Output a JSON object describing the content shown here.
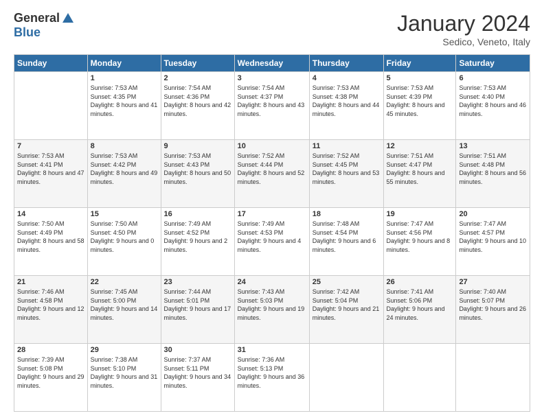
{
  "header": {
    "logo_general": "General",
    "logo_blue": "Blue",
    "month_title": "January 2024",
    "location": "Sedico, Veneto, Italy"
  },
  "days_header": [
    "Sunday",
    "Monday",
    "Tuesday",
    "Wednesday",
    "Thursday",
    "Friday",
    "Saturday"
  ],
  "weeks": [
    [
      {
        "day": "",
        "sunrise": "",
        "sunset": "",
        "daylight": ""
      },
      {
        "day": "1",
        "sunrise": "Sunrise: 7:53 AM",
        "sunset": "Sunset: 4:35 PM",
        "daylight": "Daylight: 8 hours and 41 minutes."
      },
      {
        "day": "2",
        "sunrise": "Sunrise: 7:54 AM",
        "sunset": "Sunset: 4:36 PM",
        "daylight": "Daylight: 8 hours and 42 minutes."
      },
      {
        "day": "3",
        "sunrise": "Sunrise: 7:54 AM",
        "sunset": "Sunset: 4:37 PM",
        "daylight": "Daylight: 8 hours and 43 minutes."
      },
      {
        "day": "4",
        "sunrise": "Sunrise: 7:53 AM",
        "sunset": "Sunset: 4:38 PM",
        "daylight": "Daylight: 8 hours and 44 minutes."
      },
      {
        "day": "5",
        "sunrise": "Sunrise: 7:53 AM",
        "sunset": "Sunset: 4:39 PM",
        "daylight": "Daylight: 8 hours and 45 minutes."
      },
      {
        "day": "6",
        "sunrise": "Sunrise: 7:53 AM",
        "sunset": "Sunset: 4:40 PM",
        "daylight": "Daylight: 8 hours and 46 minutes."
      }
    ],
    [
      {
        "day": "7",
        "sunrise": "Sunrise: 7:53 AM",
        "sunset": "Sunset: 4:41 PM",
        "daylight": "Daylight: 8 hours and 47 minutes."
      },
      {
        "day": "8",
        "sunrise": "Sunrise: 7:53 AM",
        "sunset": "Sunset: 4:42 PM",
        "daylight": "Daylight: 8 hours and 49 minutes."
      },
      {
        "day": "9",
        "sunrise": "Sunrise: 7:53 AM",
        "sunset": "Sunset: 4:43 PM",
        "daylight": "Daylight: 8 hours and 50 minutes."
      },
      {
        "day": "10",
        "sunrise": "Sunrise: 7:52 AM",
        "sunset": "Sunset: 4:44 PM",
        "daylight": "Daylight: 8 hours and 52 minutes."
      },
      {
        "day": "11",
        "sunrise": "Sunrise: 7:52 AM",
        "sunset": "Sunset: 4:45 PM",
        "daylight": "Daylight: 8 hours and 53 minutes."
      },
      {
        "day": "12",
        "sunrise": "Sunrise: 7:51 AM",
        "sunset": "Sunset: 4:47 PM",
        "daylight": "Daylight: 8 hours and 55 minutes."
      },
      {
        "day": "13",
        "sunrise": "Sunrise: 7:51 AM",
        "sunset": "Sunset: 4:48 PM",
        "daylight": "Daylight: 8 hours and 56 minutes."
      }
    ],
    [
      {
        "day": "14",
        "sunrise": "Sunrise: 7:50 AM",
        "sunset": "Sunset: 4:49 PM",
        "daylight": "Daylight: 8 hours and 58 minutes."
      },
      {
        "day": "15",
        "sunrise": "Sunrise: 7:50 AM",
        "sunset": "Sunset: 4:50 PM",
        "daylight": "Daylight: 9 hours and 0 minutes."
      },
      {
        "day": "16",
        "sunrise": "Sunrise: 7:49 AM",
        "sunset": "Sunset: 4:52 PM",
        "daylight": "Daylight: 9 hours and 2 minutes."
      },
      {
        "day": "17",
        "sunrise": "Sunrise: 7:49 AM",
        "sunset": "Sunset: 4:53 PM",
        "daylight": "Daylight: 9 hours and 4 minutes."
      },
      {
        "day": "18",
        "sunrise": "Sunrise: 7:48 AM",
        "sunset": "Sunset: 4:54 PM",
        "daylight": "Daylight: 9 hours and 6 minutes."
      },
      {
        "day": "19",
        "sunrise": "Sunrise: 7:47 AM",
        "sunset": "Sunset: 4:56 PM",
        "daylight": "Daylight: 9 hours and 8 minutes."
      },
      {
        "day": "20",
        "sunrise": "Sunrise: 7:47 AM",
        "sunset": "Sunset: 4:57 PM",
        "daylight": "Daylight: 9 hours and 10 minutes."
      }
    ],
    [
      {
        "day": "21",
        "sunrise": "Sunrise: 7:46 AM",
        "sunset": "Sunset: 4:58 PM",
        "daylight": "Daylight: 9 hours and 12 minutes."
      },
      {
        "day": "22",
        "sunrise": "Sunrise: 7:45 AM",
        "sunset": "Sunset: 5:00 PM",
        "daylight": "Daylight: 9 hours and 14 minutes."
      },
      {
        "day": "23",
        "sunrise": "Sunrise: 7:44 AM",
        "sunset": "Sunset: 5:01 PM",
        "daylight": "Daylight: 9 hours and 17 minutes."
      },
      {
        "day": "24",
        "sunrise": "Sunrise: 7:43 AM",
        "sunset": "Sunset: 5:03 PM",
        "daylight": "Daylight: 9 hours and 19 minutes."
      },
      {
        "day": "25",
        "sunrise": "Sunrise: 7:42 AM",
        "sunset": "Sunset: 5:04 PM",
        "daylight": "Daylight: 9 hours and 21 minutes."
      },
      {
        "day": "26",
        "sunrise": "Sunrise: 7:41 AM",
        "sunset": "Sunset: 5:06 PM",
        "daylight": "Daylight: 9 hours and 24 minutes."
      },
      {
        "day": "27",
        "sunrise": "Sunrise: 7:40 AM",
        "sunset": "Sunset: 5:07 PM",
        "daylight": "Daylight: 9 hours and 26 minutes."
      }
    ],
    [
      {
        "day": "28",
        "sunrise": "Sunrise: 7:39 AM",
        "sunset": "Sunset: 5:08 PM",
        "daylight": "Daylight: 9 hours and 29 minutes."
      },
      {
        "day": "29",
        "sunrise": "Sunrise: 7:38 AM",
        "sunset": "Sunset: 5:10 PM",
        "daylight": "Daylight: 9 hours and 31 minutes."
      },
      {
        "day": "30",
        "sunrise": "Sunrise: 7:37 AM",
        "sunset": "Sunset: 5:11 PM",
        "daylight": "Daylight: 9 hours and 34 minutes."
      },
      {
        "day": "31",
        "sunrise": "Sunrise: 7:36 AM",
        "sunset": "Sunset: 5:13 PM",
        "daylight": "Daylight: 9 hours and 36 minutes."
      },
      {
        "day": "",
        "sunrise": "",
        "sunset": "",
        "daylight": ""
      },
      {
        "day": "",
        "sunrise": "",
        "sunset": "",
        "daylight": ""
      },
      {
        "day": "",
        "sunrise": "",
        "sunset": "",
        "daylight": ""
      }
    ]
  ]
}
